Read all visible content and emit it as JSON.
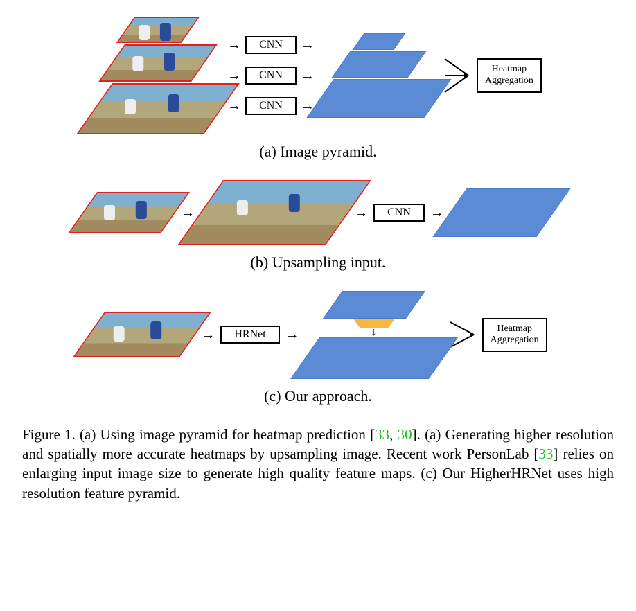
{
  "labels": {
    "cnn": "CNN",
    "hrnet": "HRNet",
    "heatmap_agg_l1": "Heatmap",
    "heatmap_agg_l2": "Aggregation"
  },
  "subcaptions": {
    "a": "(a) Image pyramid.",
    "b": "(b) Upsampling input.",
    "c": "(c) Our approach."
  },
  "caption": {
    "lead": "Figure 1. (a) Using image pyramid for heatmap prediction [",
    "c1": "33",
    "sep1": ", ",
    "c2": "30",
    "mid1": "]. (a) Generating higher resolution and spatially more accurate heatmaps by upsampling image. Recent work PersonLab [",
    "c3": "33",
    "mid2": "] relies on enlarging input image size to generate high quality feature maps. (c) Our HigherHRNet uses high resolution feature pyramid."
  }
}
